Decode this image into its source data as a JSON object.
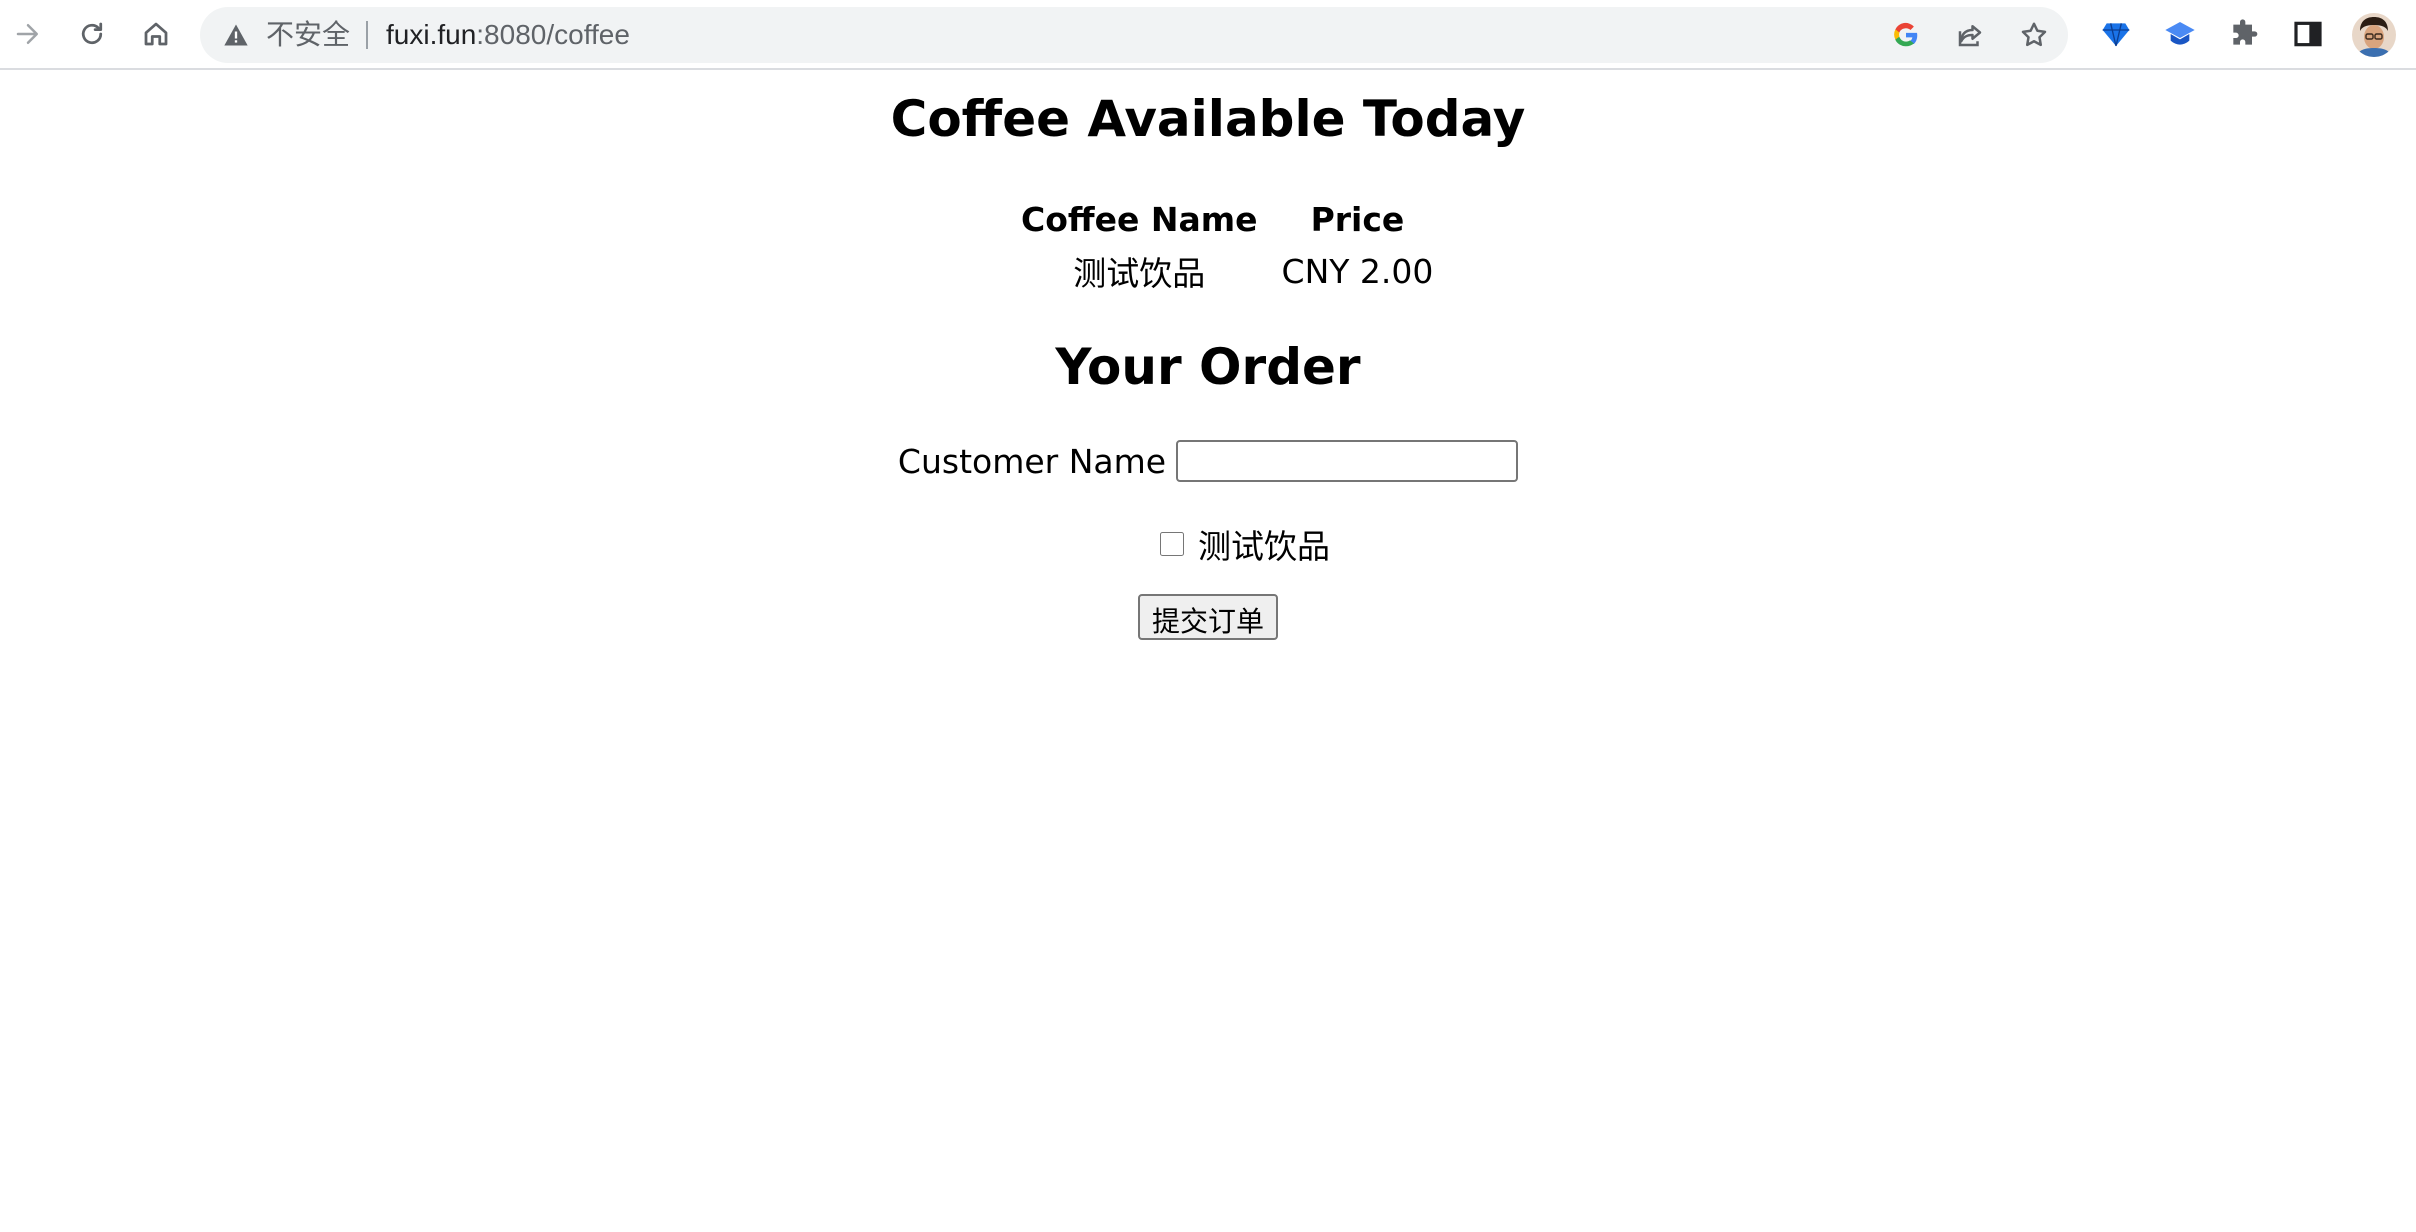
{
  "browser": {
    "security_label": "不安全",
    "url_host": "fuxi.fun",
    "url_rest": ":8080/coffee",
    "icons": {
      "back": "arrow-right-icon",
      "reload": "reload-icon",
      "home": "home-icon",
      "warning": "warning-icon",
      "google": "google-icon",
      "share": "share-icon",
      "bookmark": "star-icon",
      "extension1": "diamond-extension-icon",
      "extension2": "graduation-cap-extension-icon",
      "extensions": "puzzle-icon",
      "sidepanel": "side-panel-icon"
    }
  },
  "page": {
    "heading_available": "Coffee Available Today",
    "menu": {
      "headers": [
        "Coffee Name",
        "Price"
      ],
      "rows": [
        [
          "测试饮品",
          "CNY 2.00"
        ]
      ]
    },
    "heading_order": "Your Order",
    "form": {
      "customer_name_label": "Customer Name",
      "customer_name_value": "",
      "items": [
        {
          "label": "测试饮品",
          "checked": false
        }
      ],
      "submit_label": "提交订单"
    }
  }
}
